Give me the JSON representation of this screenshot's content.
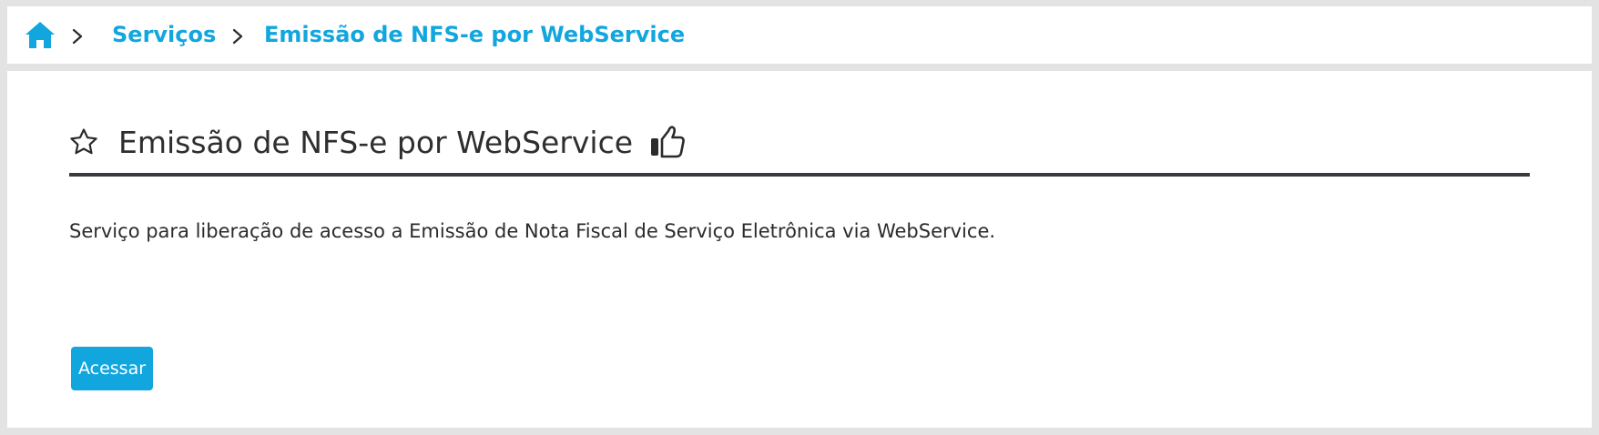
{
  "breadcrumb": {
    "home_icon": "home-icon",
    "separator_icon": "chevron-right-icon",
    "items": [
      {
        "label": "Serviços"
      },
      {
        "label": "Emissão de NFS-e por WebService"
      }
    ]
  },
  "service": {
    "favorite_icon": "star-outline-icon",
    "like_icon": "thumbs-up-icon",
    "title": "Emissão de NFS-e por WebService",
    "description": "Serviço para liberação de acesso a Emissão de Nota Fiscal de Serviço Eletrônica via WebService.",
    "access_label": "Acessar"
  },
  "colors": {
    "accent": "#12a6df",
    "background": "#e3e3e3",
    "surface": "#ffffff",
    "title_rule": "#373a40",
    "text": "#2b2b2b"
  }
}
